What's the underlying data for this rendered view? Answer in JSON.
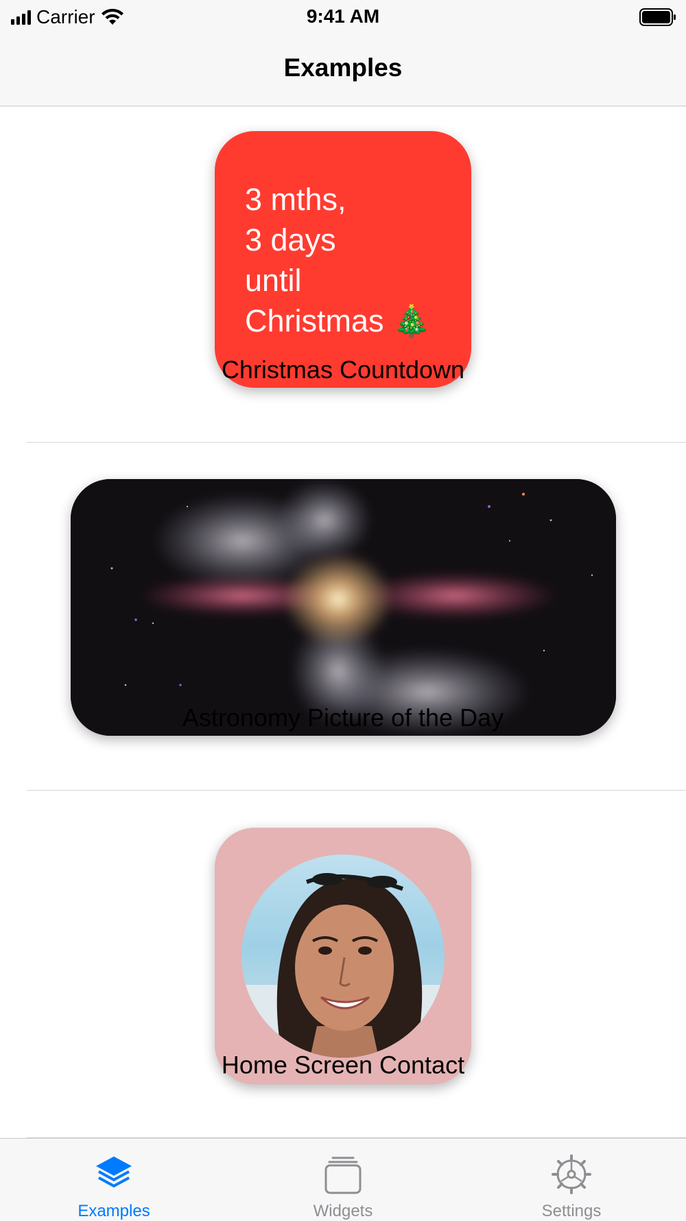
{
  "status_bar": {
    "carrier": "Carrier",
    "time": "9:41 AM"
  },
  "nav": {
    "title": "Examples"
  },
  "examples": [
    {
      "widget_text": "3 mths,\n3 days\nuntil\nChristmas 🎄",
      "caption": "Christmas Countdown",
      "color": "#ff3b30"
    },
    {
      "caption": "Astronomy Picture of the Day"
    },
    {
      "caption": "Home Screen Contact",
      "color": "#e5b3b3"
    }
  ],
  "tabs": [
    {
      "label": "Examples",
      "icon": "layers-icon",
      "selected": true
    },
    {
      "label": "Widgets",
      "icon": "widgets-stack-icon",
      "selected": false
    },
    {
      "label": "Settings",
      "icon": "gear-icon",
      "selected": false
    }
  ],
  "colors": {
    "accent": "#007aff",
    "tab_inactive": "#8e8e93"
  }
}
